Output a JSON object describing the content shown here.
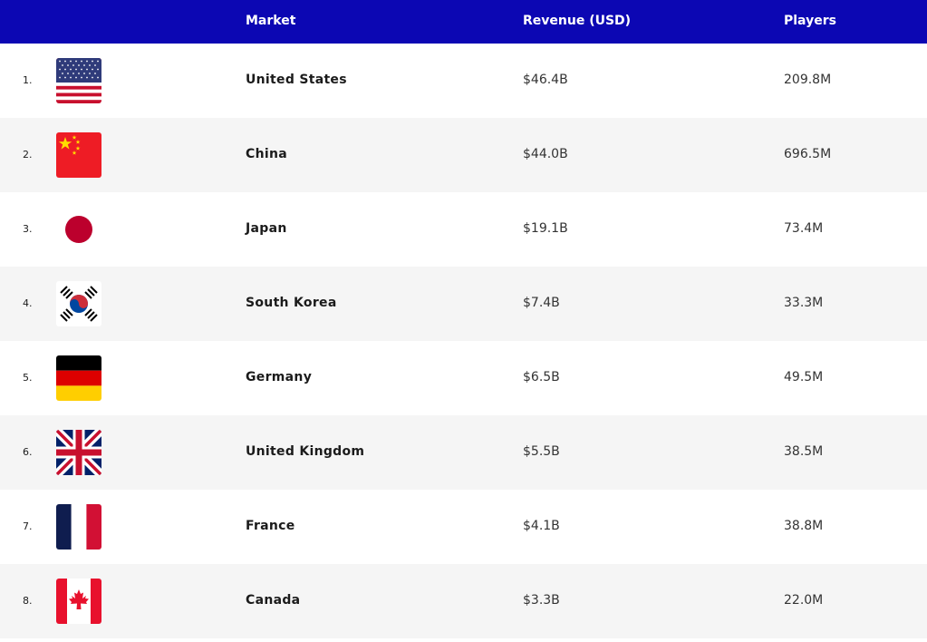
{
  "header": {
    "market": "Market",
    "revenue": "Revenue (USD)",
    "players": "Players"
  },
  "rows": [
    {
      "rank": "1.",
      "flag_icon": "us-flag-icon",
      "market": "United States",
      "revenue": "$46.4B",
      "players": "209.8M"
    },
    {
      "rank": "2.",
      "flag_icon": "china-flag-icon",
      "market": "China",
      "revenue": "$44.0B",
      "players": "696.5M"
    },
    {
      "rank": "3.",
      "flag_icon": "japan-flag-icon",
      "market": "Japan",
      "revenue": "$19.1B",
      "players": "73.4M"
    },
    {
      "rank": "4.",
      "flag_icon": "south-korea-flag-icon",
      "market": "South Korea",
      "revenue": "$7.4B",
      "players": "33.3M"
    },
    {
      "rank": "5.",
      "flag_icon": "germany-flag-icon",
      "market": "Germany",
      "revenue": "$6.5B",
      "players": "49.5M"
    },
    {
      "rank": "6.",
      "flag_icon": "uk-flag-icon",
      "market": "United Kingdom",
      "revenue": "$5.5B",
      "players": "38.5M"
    },
    {
      "rank": "7.",
      "flag_icon": "france-flag-icon",
      "market": "France",
      "revenue": "$4.1B",
      "players": "38.8M"
    },
    {
      "rank": "8.",
      "flag_icon": "canada-flag-icon",
      "market": "Canada",
      "revenue": "$3.3B",
      "players": "22.0M"
    }
  ],
  "colors": {
    "header_bg": "#0c07b3",
    "row_alt_bg": "#f5f5f5"
  }
}
